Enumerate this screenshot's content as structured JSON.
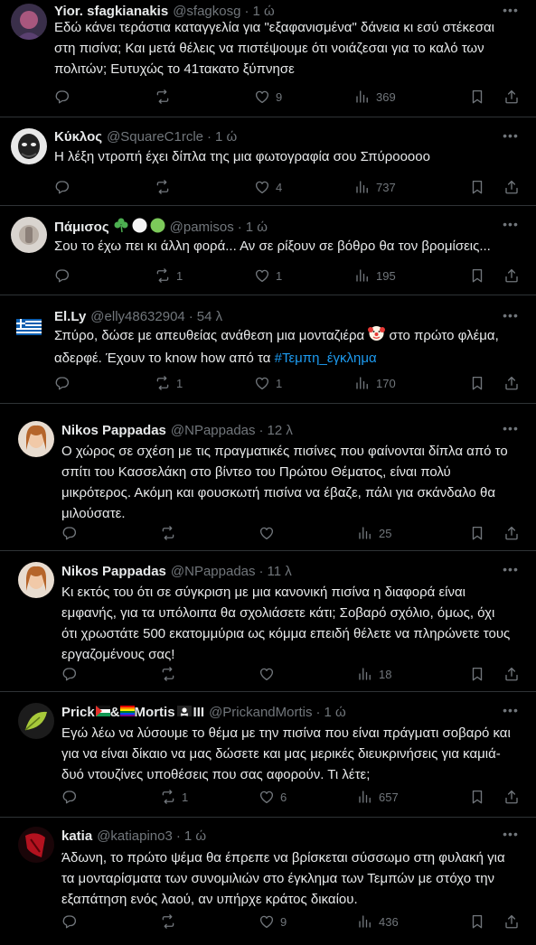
{
  "tweets": [
    {
      "name": "Yior. sfagkianakis",
      "handle": "@sfagkosg",
      "time": "1 ώ",
      "text": "Εδώ κάνει τεράστια καταγγελία για \"εξαφανισμένα\" δάνεια κι εσύ στέκεσαι στη πισίνα; Και μετά θέλεις να πιστέψουμε ότι νοιάζεσαι για το καλό των πολιτών; Ευτυχώς το 41τακατο ξύπνησε",
      "replies": "",
      "reposts": "",
      "likes": "9",
      "views": "369"
    },
    {
      "name": "Κύκλος",
      "handle": "@SquareC1rcle",
      "time": "1 ώ",
      "text": "Η λέξη ντροπή έχει δίπλα της μια φωτογραφία σου Σπύροοooo",
      "replies": "",
      "reposts": "",
      "likes": "4",
      "views": "737"
    },
    {
      "name": "Πάμισος",
      "handle": "@pamisos",
      "time": "1 ώ",
      "text": "Σου το έχω πει κι άλλη φορά... Αν σε ρίξουν σε βόθρο θα τον βρομίσεις...",
      "replies": "",
      "reposts": "1",
      "likes": "1",
      "views": "195"
    },
    {
      "name": "El.Ly",
      "handle": "@elly48632904",
      "time": "54 λ",
      "text_a": "Σπύρο, δώσε με απευθείας ανάθεση μια μονταζιέρα ",
      "text_b": " στο πρώτο φλέμα, αδερφέ. Έχουν το know how από τα ",
      "hashtag": "#Τεμπη_έγκλημα",
      "replies": "",
      "reposts": "1",
      "likes": "1",
      "views": "170"
    },
    {
      "name": "Nikos Pappadas",
      "handle": "@NPappadas",
      "time": "12 λ",
      "text": "Ο χώρος σε σχέση με τις πραγματικές πισίνες που φαίνονται δίπλα από το σπίτι του Κασσελάκη στο βίντεο του Πρώτου Θέματος, είναι πολύ μικρότερος. Ακόμη και φουσκωτή πισίνα να έβαζε, πάλι για σκάνδαλο θα μιλούσατε.",
      "replies": "",
      "reposts": "",
      "likes": "",
      "views": "25"
    },
    {
      "name": "Nikos Pappadas",
      "handle": "@NPappadas",
      "time": "11 λ",
      "text": "Κι εκτός του ότι σε σύγκριση με μια κανονική πισίνα η διαφορά είναι εμφανής, για τα υπόλοιπα θα σχολιάσετε κάτι; Σοβαρό σχόλιο, όμως, όχι ότι χρωστάτε 500 εκατομμύρια ως κόμμα επειδή θέλετε να πληρώνετε τους εργαζομένους σας!",
      "replies": "",
      "reposts": "",
      "likes": "",
      "views": "18"
    },
    {
      "name_a": "Prick",
      "name_b": "&",
      "name_c": "Mortis",
      "name_d": "III",
      "handle": "@PrickandMortis",
      "time": "1 ώ",
      "text": "Εγώ λέω να λύσουμε το θέμα με την πισίνα που είναι πράγματι σοβαρό και για να είναι δίκαιο να μας δώσετε και μας μερικές διευκρινήσεις για καμιά-δυό ντουζίνες υποθέσεις που σας αφορούν. Τι λέτε;",
      "replies": "",
      "reposts": "1",
      "likes": "6",
      "views": "657"
    },
    {
      "name": "katia",
      "handle": "@katiapino3",
      "time": "1 ώ",
      "text": "Άδωνη, το πρώτο ψέμα θα έπρεπε να βρίσκεται σύσσωμο στη φυλακή για τα μονταρίσματα των συνομιλιών στο έγκλημα των Τεμπών με στόχο την εξαπάτηση ενός λαού, αν υπήρχε κράτος δικαίου.",
      "replies": "",
      "reposts": "",
      "likes": "9",
      "views": "436"
    }
  ],
  "icons": [
    "reply-icon",
    "repost-icon",
    "like-icon",
    "views-icon",
    "bookmark-icon",
    "share-icon",
    "more-icon"
  ],
  "colors": {
    "background": "#000000",
    "text": "#e7e9ea",
    "muted": "#71767b",
    "link": "#1d9bf0",
    "divider": "#2f3336"
  }
}
